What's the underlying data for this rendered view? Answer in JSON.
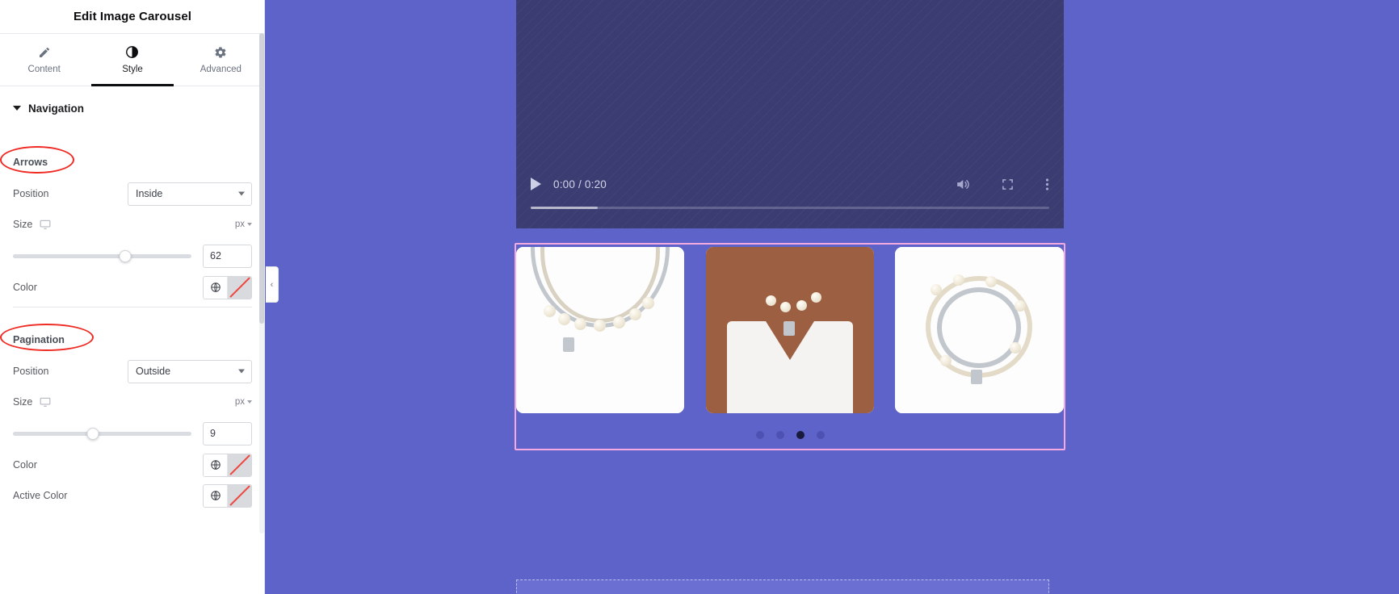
{
  "panel": {
    "title": "Edit Image Carousel",
    "tabs": [
      {
        "label": "Content",
        "icon": "pencil-icon",
        "active": false
      },
      {
        "label": "Style",
        "icon": "contrast-icon",
        "active": true
      },
      {
        "label": "Advanced",
        "icon": "gear-icon",
        "active": false
      }
    ],
    "section": {
      "title": "Navigation",
      "expanded": true
    },
    "groups": [
      {
        "title": "Arrows",
        "annotated": true,
        "position": {
          "label": "Position",
          "value": "Inside",
          "options": [
            "Inside",
            "Outside"
          ]
        },
        "size": {
          "label": "Size",
          "unit": "px",
          "value": "62",
          "slider_percent": 63,
          "responsive_icon": "desktop-icon"
        },
        "color": {
          "label": "Color",
          "globe_icon": "globe-icon",
          "swatch": "none"
        }
      },
      {
        "title": "Pagination",
        "annotated": true,
        "position": {
          "label": "Position",
          "value": "Outside",
          "options": [
            "Inside",
            "Outside"
          ]
        },
        "size": {
          "label": "Size",
          "unit": "px",
          "value": "9",
          "slider_percent": 45,
          "responsive_icon": "desktop-icon"
        },
        "color": {
          "label": "Color",
          "globe_icon": "globe-icon",
          "swatch": "none"
        },
        "active_color": {
          "label": "Active Color",
          "globe_icon": "globe-icon",
          "swatch": "none"
        }
      }
    ],
    "collapse_handle": "‹"
  },
  "canvas": {
    "video": {
      "time_display": "0:00 / 0:20",
      "play_icon": "play-icon",
      "volume_icon": "volume-icon",
      "fullscreen_icon": "fullscreen-icon",
      "more_icon": "more-vertical-icon"
    },
    "carousel": {
      "slides": [
        {
          "alt": "pearl and chain necklace on white"
        },
        {
          "alt": "model wearing pearl chain necklace"
        },
        {
          "alt": "coiled pearl chain bracelet"
        }
      ],
      "dots": [
        {
          "active": false
        },
        {
          "active": false
        },
        {
          "active": true
        },
        {
          "active": false
        }
      ]
    }
  },
  "colors": {
    "canvas_bg": "#5e63ca",
    "video_bg": "#3b3d72",
    "frame_outline": "#f4a9e0",
    "annotation": "#ef2b23",
    "dot_active": "#191b3d",
    "dot_inactive": "#4d52b2",
    "tab_active": "#0c0d0e"
  }
}
